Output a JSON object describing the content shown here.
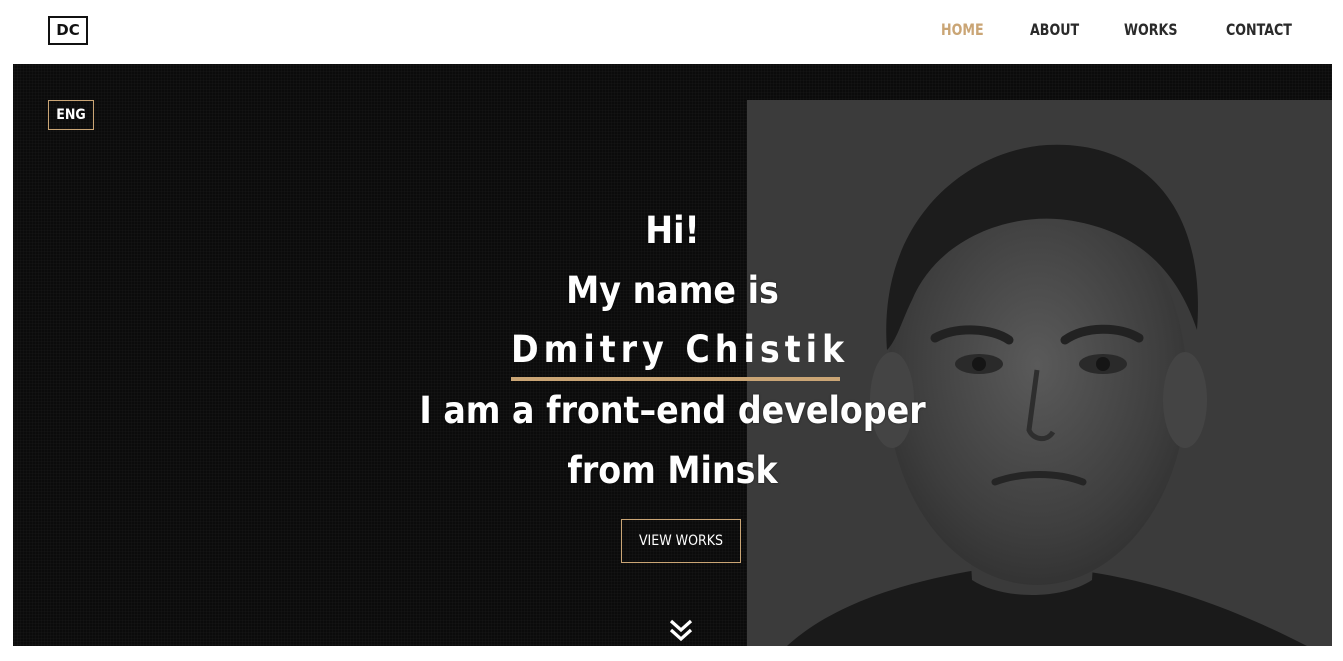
{
  "header": {
    "logo_text": "DC",
    "nav": [
      {
        "label": "HOME",
        "active": true
      },
      {
        "label": "ABOUT",
        "active": false
      },
      {
        "label": "WORKS",
        "active": false
      },
      {
        "label": "CONTACT",
        "active": false
      }
    ]
  },
  "hero": {
    "lang_button": "ENG",
    "greeting": "Hi!",
    "intro": "My name is",
    "name": "Dmitry Chistik",
    "role": "I am a front–end developer",
    "location": "from Minsk",
    "cta_label": "VIEW WORKS",
    "scroll_icon": "double-chevron-down-icon"
  },
  "colors": {
    "accent": "#caa575",
    "hero_bg": "#0b0b0b",
    "photo_bg": "#3a3a3a",
    "text_dark": "#2a2a2a",
    "header_bg": "#ffffff"
  }
}
